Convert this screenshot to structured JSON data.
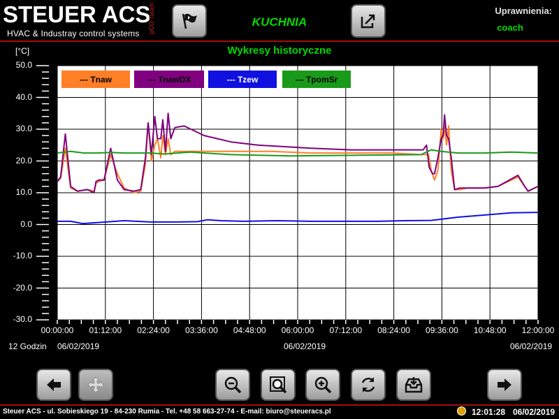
{
  "header": {
    "brand": "STEUER ACS",
    "brand_sub": "HVAC & Industray control systems",
    "brand_side": "pCO Touch",
    "room_title": "KUCHNIA",
    "permissions_label": "Uprawnienia:",
    "permissions_user": "coach",
    "flag_icon": "flag-icon",
    "export_icon": "export-icon"
  },
  "range_label": "12 Godzin",
  "chart_data": {
    "type": "line",
    "title": "Wykresy historyczne",
    "ylabel": "[°C]",
    "ylim": [
      -30,
      50
    ],
    "yticks": [
      "50.0",
      "40.0",
      "30.0",
      "20.0",
      "10.0",
      "0.0",
      "-10.0",
      "-20.0",
      "-30.0"
    ],
    "xlim": [
      0,
      720
    ],
    "xticks": [
      {
        "v": 0,
        "label": "00:00:00"
      },
      {
        "v": 72,
        "label": "01:12:00"
      },
      {
        "v": 144,
        "label": "02:24:00"
      },
      {
        "v": 216,
        "label": "03:36:00"
      },
      {
        "v": 288,
        "label": "04:48:00"
      },
      {
        "v": 360,
        "label": "06:00:00"
      },
      {
        "v": 432,
        "label": "07:12:00"
      },
      {
        "v": 504,
        "label": "08:24:00"
      },
      {
        "v": 576,
        "label": "09:36:00"
      },
      {
        "v": 648,
        "label": "10:48:00"
      },
      {
        "v": 720,
        "label": "12:00:00"
      }
    ],
    "dates": [
      "06/02/2019",
      "06/02/2019",
      "06/02/2019"
    ],
    "grid": true,
    "legend_position": "top-left",
    "series": [
      {
        "name": "Tnaw",
        "color": "#ff7f27",
        "x": [
          0,
          5,
          12,
          20,
          30,
          45,
          55,
          58,
          62,
          70,
          80,
          90,
          100,
          115,
          125,
          132,
          136,
          141,
          146,
          150,
          155,
          158,
          162,
          166,
          170,
          176,
          190,
          215,
          260,
          320,
          380,
          440,
          500,
          545,
          556,
          560,
          565,
          570,
          575,
          578,
          580,
          583,
          586,
          590,
          595,
          603,
          615,
          640,
          660,
          690,
          700,
          705,
          715,
          720
        ],
        "y": [
          13.5,
          14.5,
          24,
          11.5,
          10.5,
          11,
          10.5,
          13,
          13.5,
          14,
          22,
          16,
          11.5,
          10,
          10.5,
          19,
          32,
          20,
          25,
          27,
          21,
          28,
          22,
          27,
          22,
          23,
          23,
          23,
          23,
          23,
          22.5,
          22.5,
          22.5,
          22,
          22,
          17,
          14,
          17,
          30,
          27,
          31,
          25,
          31,
          17,
          11,
          11,
          11.5,
          11.5,
          12,
          15,
          12,
          10.5,
          11.5,
          12
        ]
      },
      {
        "name": "TnawDX",
        "color": "#800080",
        "x": [
          0,
          5,
          12,
          20,
          30,
          45,
          55,
          58,
          62,
          70,
          80,
          90,
          100,
          115,
          125,
          132,
          136,
          141,
          146,
          150,
          155,
          158,
          162,
          166,
          170,
          176,
          190,
          220,
          260,
          300,
          340,
          380,
          440,
          500,
          545,
          548,
          553,
          557,
          562,
          565,
          570,
          575,
          578,
          580,
          583,
          586,
          590,
          595,
          603,
          615,
          640,
          660,
          690,
          700,
          705,
          715,
          720
        ],
        "y": [
          13.5,
          15,
          28.5,
          12,
          10.5,
          11,
          10,
          13.5,
          14,
          14,
          24,
          14,
          11,
          10.5,
          11,
          21,
          32,
          22,
          34,
          27,
          27,
          33,
          23,
          35,
          27,
          30.5,
          31,
          28,
          26,
          25,
          24.5,
          24,
          23.5,
          23.5,
          23.5,
          23.5,
          25,
          18,
          16,
          16,
          21,
          27,
          28,
          34.5,
          28,
          27,
          21,
          11,
          11.5,
          11.5,
          11.5,
          12,
          15.5,
          12,
          10.5,
          11.5,
          12
        ]
      },
      {
        "name": "Tzew",
        "color": "#1010e0",
        "x": [
          0,
          20,
          38,
          60,
          100,
          140,
          180,
          210,
          225,
          245,
          280,
          330,
          380,
          430,
          480,
          520,
          560,
          600,
          640,
          680,
          720
        ],
        "y": [
          1,
          1,
          0.3,
          0.6,
          1.2,
          0.8,
          0.8,
          0.9,
          1.5,
          1.2,
          1,
          1.2,
          1,
          1,
          1,
          1.2,
          1.3,
          2.3,
          3,
          3.7,
          3.8
        ]
      },
      {
        "name": "TpomSr",
        "color": "#1a9a1a",
        "x": [
          0,
          20,
          40,
          60,
          80,
          100,
          120,
          140,
          160,
          180,
          200,
          220,
          260,
          300,
          350,
          400,
          450,
          500,
          545,
          555,
          560,
          575,
          600,
          640,
          680,
          720
        ],
        "y": [
          22.5,
          23,
          22.5,
          22.5,
          22.7,
          22.5,
          22.5,
          22.5,
          22.2,
          22.5,
          22.8,
          22.5,
          22,
          21.8,
          21.6,
          21.7,
          21.8,
          21.9,
          22,
          23,
          23.5,
          23,
          22.5,
          22.5,
          22.8,
          22.5
        ]
      }
    ]
  },
  "toolbar": {
    "prev_icon": "arrow-left-icon",
    "move_icon": "move-icon",
    "zoom_out_icon": "zoom-out-icon",
    "zoom_fit_icon": "zoom-fit-icon",
    "zoom_in_icon": "zoom-in-icon",
    "refresh_icon": "refresh-icon",
    "save_icon": "save-tray-icon",
    "next_icon": "arrow-right-icon"
  },
  "footer": {
    "address": "Steuer ACS - ul. Sobieskiego 19 - 84-230 Rumia - Tel. +48 58 663-27-74 - E-mail: biuro@steueracs.pl",
    "time": "12:01:28",
    "date": "06/02/2019"
  }
}
